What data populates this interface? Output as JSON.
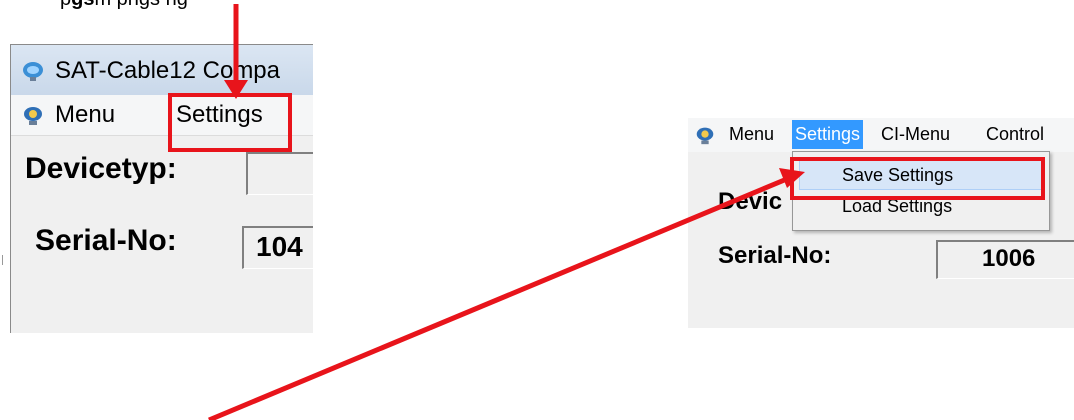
{
  "caption": {
    "before": "p",
    "bold": "gs",
    "after": "m          pngs  ng"
  },
  "left_window": {
    "title": "SAT-Cable12 Compa",
    "menu": [
      "Menu",
      "Settings"
    ],
    "devicetyp_label": "Devicetyp:",
    "serial_label": "Serial-No:",
    "serial_value": "104"
  },
  "right_window": {
    "menu": [
      "Menu",
      "Settings",
      "CI-Menu",
      "Control"
    ],
    "dropdown": [
      "Save Settings",
      "Load Settings"
    ],
    "devicetyp_label": "Devic",
    "serial_label": "Serial-No:",
    "serial_value": "1006"
  },
  "colors": {
    "highlight": "#e8141b",
    "menu_selected": "#3399ff",
    "hover": "#d7e6f8"
  },
  "icons": [
    "app-icon",
    "menu-app-icon"
  ]
}
